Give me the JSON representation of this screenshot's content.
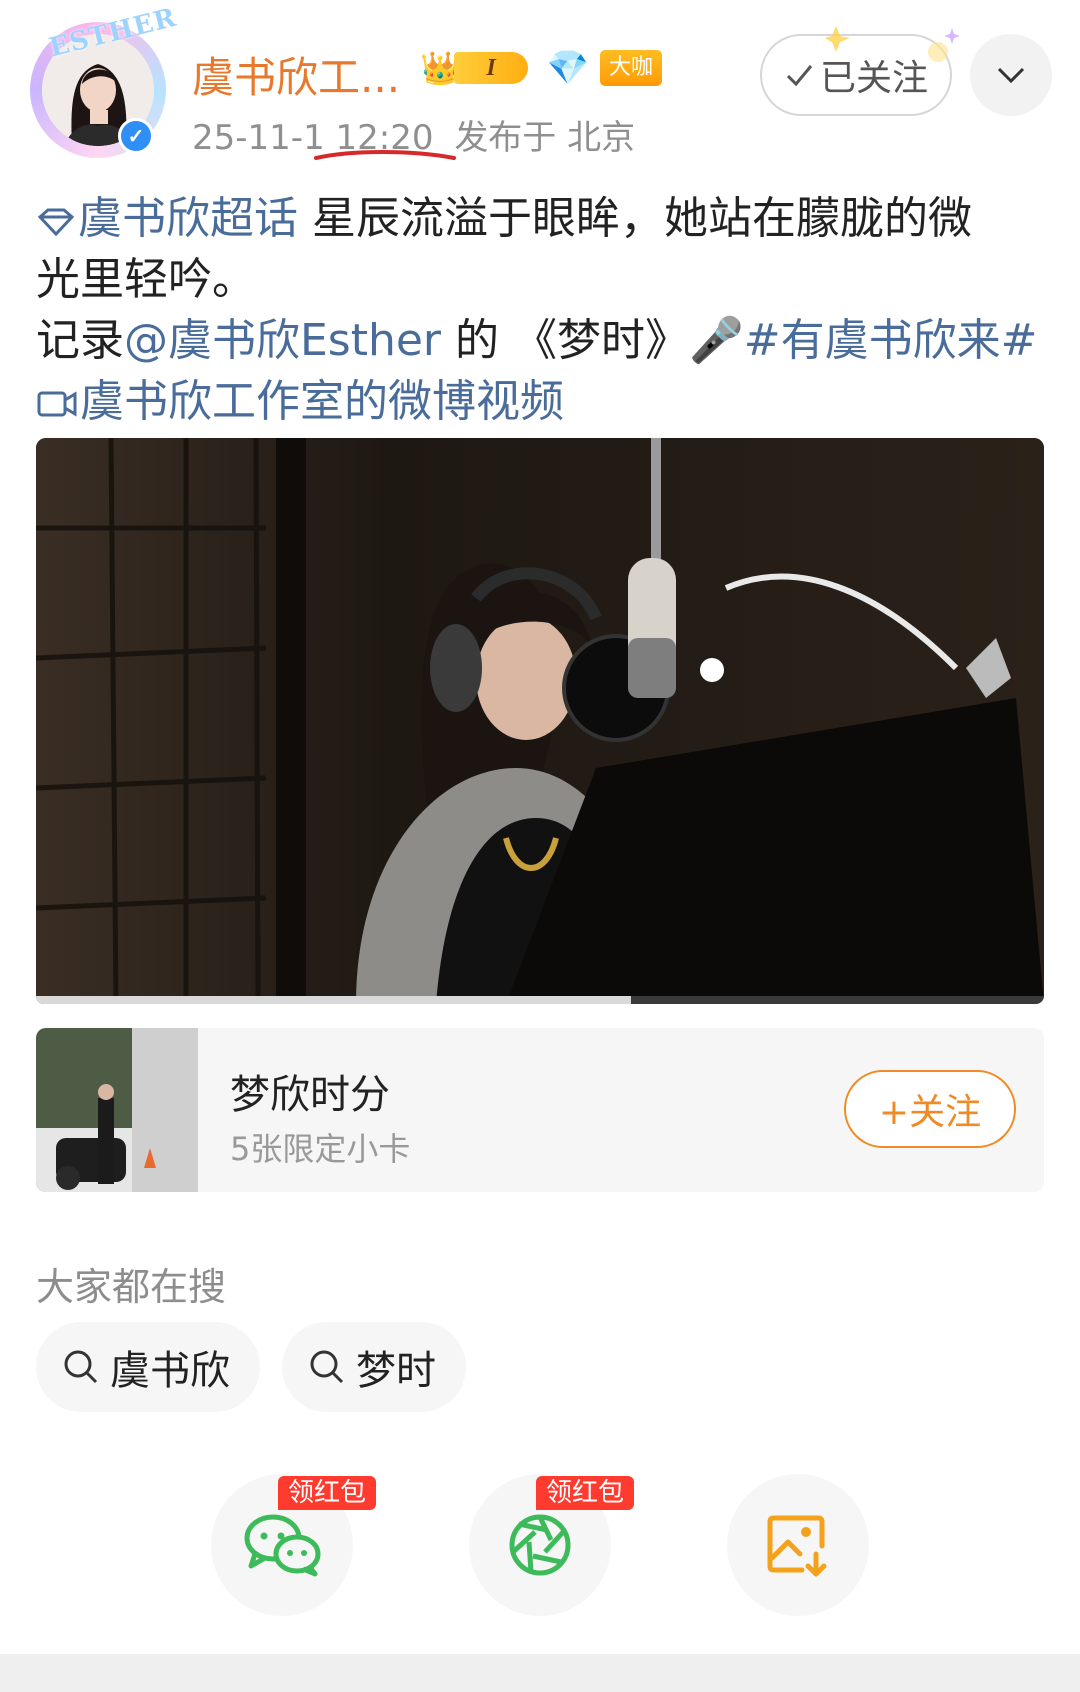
{
  "header": {
    "avatar_deco_text": "ESTHER",
    "name": "虞书欣工...",
    "level_badge": "I",
    "vip_badge": "大咖",
    "post_time": "25-11-1 12:20",
    "location": "发布于 北京",
    "follow_label": "已关注"
  },
  "post": {
    "topic_label": "虞书欣超话",
    "line1_text": " 星辰流溢于眼眸，她站在朦胧的微",
    "line2_text": "光里轻吟。",
    "line3_prefix": "记录",
    "mention": "@虞书欣Esther",
    "line3_middle": " 的 《梦时》🎤",
    "hashtag": "#有虞书欣来#",
    "video_link": "虞书欣工作室的微博视频"
  },
  "video": {
    "progress": 0.59
  },
  "card": {
    "title": "梦欣时分",
    "subtitle": "5张限定小卡",
    "follow_label": "+关注"
  },
  "search": {
    "title": "大家都在搜",
    "chips": [
      {
        "label": "虞书欣"
      },
      {
        "label": "梦时"
      }
    ]
  },
  "share": {
    "wechat_tag": "领红包",
    "moments_tag": "领红包",
    "icons": [
      "wechat-icon",
      "moments-icon",
      "save-image-icon"
    ]
  },
  "colors": {
    "brand_orange": "#e8792c",
    "link_blue": "#4a6c9a",
    "wechat_green": "#3dbb5a",
    "red_tag": "#ff3b30"
  }
}
